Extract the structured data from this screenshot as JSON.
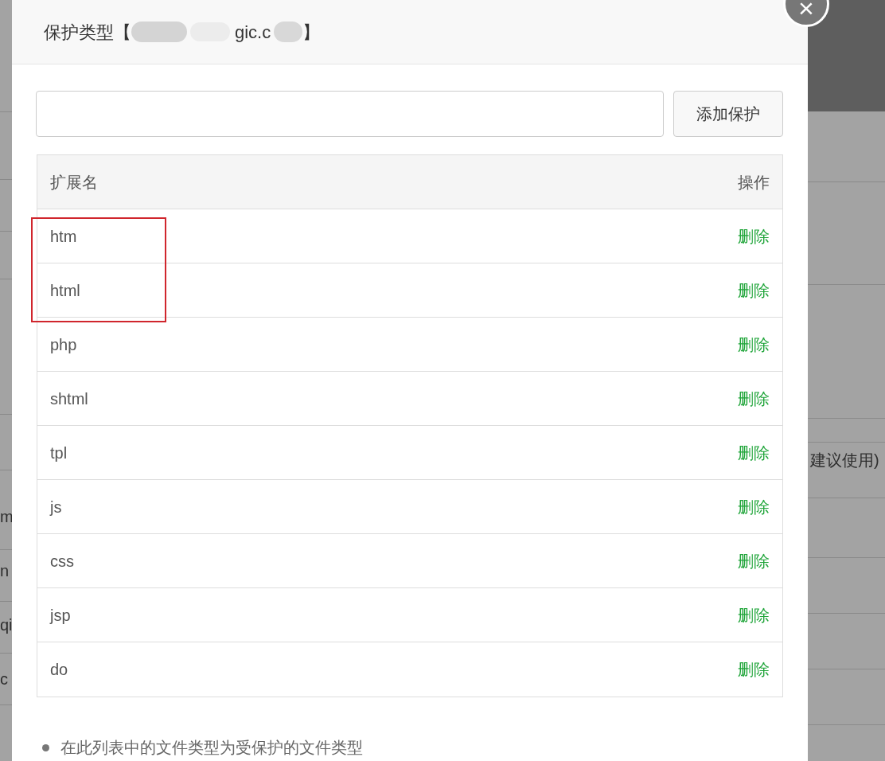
{
  "background": {
    "left_fragments": [
      "m",
      "n",
      "qi",
      "c"
    ],
    "right_fragments": [
      "建议使用)"
    ]
  },
  "dialog": {
    "title": "保护类型【",
    "title_fragment": "gic.c",
    "title_end": "】",
    "close_button": "×"
  },
  "form": {
    "add_button": "添加保护"
  },
  "table": {
    "columns": [
      "扩展名",
      "操作"
    ],
    "rows": [
      {
        "extension": "htm",
        "action": "删除",
        "highlighted": true
      },
      {
        "extension": "html",
        "action": "删除",
        "highlighted": true
      },
      {
        "extension": "php",
        "action": "删除",
        "highlighted": false
      },
      {
        "extension": "shtml",
        "action": "删除",
        "highlighted": false
      },
      {
        "extension": "tpl",
        "action": "删除",
        "highlighted": false
      },
      {
        "extension": "js",
        "action": "删除",
        "highlighted": false
      },
      {
        "extension": "css",
        "action": "删除",
        "highlighted": false
      },
      {
        "extension": "jsp",
        "action": "删除",
        "highlighted": false
      },
      {
        "extension": "do",
        "action": "删除",
        "highlighted": false
      }
    ]
  },
  "notes": [
    "在此列表中的文件类型为受保护的文件类型"
  ]
}
